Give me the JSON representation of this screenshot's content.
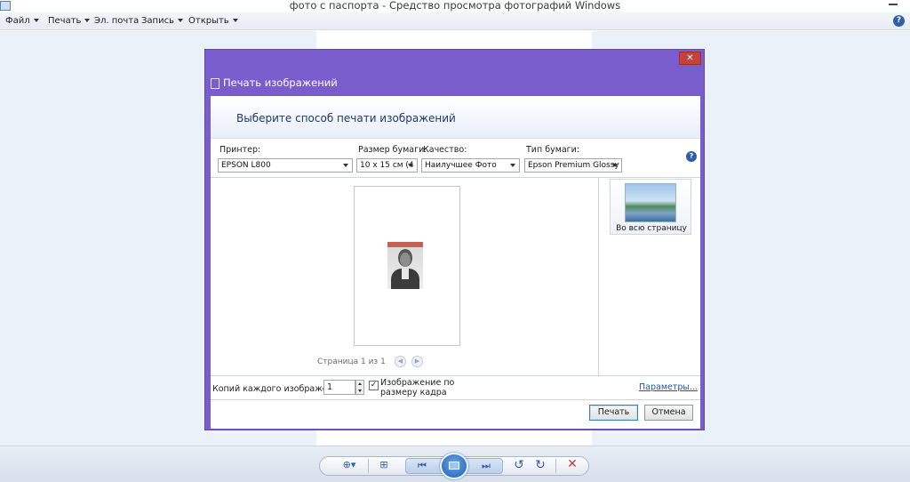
{
  "window": {
    "title": "фото с паспорта - Средство просмотра фотографий Windows"
  },
  "menubar": {
    "items": [
      {
        "label": "Файл",
        "has_arrow": true
      },
      {
        "label": "Печать",
        "has_arrow": true
      },
      {
        "label": "Эл. почта",
        "has_arrow": false
      },
      {
        "label": "Запись",
        "has_arrow": true
      },
      {
        "label": "Открыть",
        "has_arrow": true
      }
    ],
    "help_icon": "?"
  },
  "dialog": {
    "title": "Печать изображений",
    "close_icon": "✕",
    "header": "Выберите способ печати изображений",
    "printer": {
      "label": "Принтер:",
      "value": "EPSON L800"
    },
    "paper_size": {
      "label": "Размер бумаги:",
      "value": "10 x 15 см (4"
    },
    "quality": {
      "label": "Качество:",
      "value": "Наилучшее Фото"
    },
    "paper_type": {
      "label": "Тип бумаги:",
      "value": "Epson Premium Glossy"
    },
    "help_icon": "?",
    "page_indicator": "Страница 1 из 1",
    "prev_icon": "◀",
    "next_icon": "▶",
    "layout": {
      "label": "Во всю страницу"
    },
    "copies": {
      "label": "Копий каждого изображения:",
      "value": "1"
    },
    "fit_to_frame": {
      "label": "Изображение по размеру кадра",
      "checked": true,
      "check_glyph": "✓"
    },
    "options_link": "Параметры...",
    "print_button": "Печать",
    "cancel_button": "Отмена"
  },
  "toolbar": {
    "zoom_icon": "⊕▾",
    "fit_icon": "⊞",
    "prev_icon": "⏮",
    "next_icon": "⏭",
    "rotate_ccw_icon": "↺",
    "rotate_cw_icon": "↻",
    "delete_icon": "✕"
  },
  "colors": {
    "dialog_frame": "#7a5dcd",
    "close_button": "#c7413b",
    "link": "#1a55b3",
    "accent": "#2f5fa7"
  }
}
